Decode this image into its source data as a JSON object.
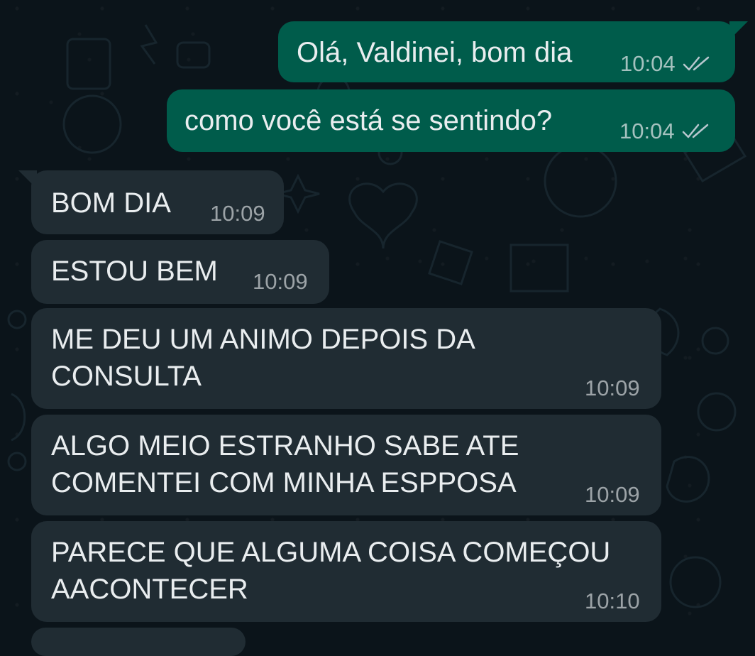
{
  "messages": [
    {
      "direction": "outgoing",
      "text": "Olá, Valdinei, bom dia",
      "time": "10:04",
      "status": "read-double-check-icon"
    },
    {
      "direction": "outgoing",
      "text": "como você está se sentindo?",
      "time": "10:04",
      "status": "read-double-check-icon"
    },
    {
      "direction": "incoming",
      "text": "BOM DIA",
      "time": "10:09"
    },
    {
      "direction": "incoming",
      "text": "ESTOU BEM",
      "time": "10:09"
    },
    {
      "direction": "incoming",
      "lines": [
        "ME DEU UM ANIMO DEPOIS DA",
        "CONSULTA"
      ],
      "time": "10:09"
    },
    {
      "direction": "incoming",
      "lines": [
        "ALGO MEIO ESTRANHO SABE ATE",
        "COMENTEI COM MINHA ESPPOSA"
      ],
      "time": "10:09"
    },
    {
      "direction": "incoming",
      "lines": [
        "PARECE QUE ALGUMA COISA COMEÇOU",
        "AACONTECER"
      ],
      "time": "10:10"
    }
  ],
  "colors": {
    "background": "#0b141a",
    "outgoing_bubble": "#005c4b",
    "incoming_bubble": "#202c33",
    "text": "#e9edef"
  }
}
